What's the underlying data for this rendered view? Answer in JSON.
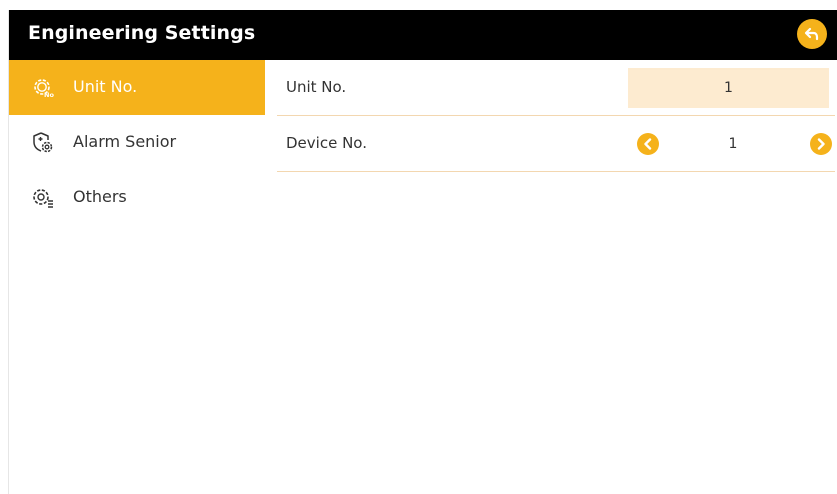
{
  "header": {
    "title": "Engineering Settings",
    "back_icon": "back-arrow-icon"
  },
  "sidebar": {
    "items": [
      {
        "label": "Unit No.",
        "icon": "gear-no-icon",
        "active": true
      },
      {
        "label": "Alarm Senior",
        "icon": "shield-gear-icon",
        "active": false
      },
      {
        "label": "Others",
        "icon": "gear-list-icon",
        "active": false
      }
    ]
  },
  "main": {
    "unit_no": {
      "label": "Unit No.",
      "value": "1"
    },
    "device_no": {
      "label": "Device No.",
      "value": "1",
      "prev_icon": "chevron-left-icon",
      "next_icon": "chevron-right-icon"
    }
  },
  "colors": {
    "accent": "#f5b21b",
    "header_bg": "#000000",
    "value_bg": "#fdebd0",
    "divider": "#f3d7b0"
  }
}
